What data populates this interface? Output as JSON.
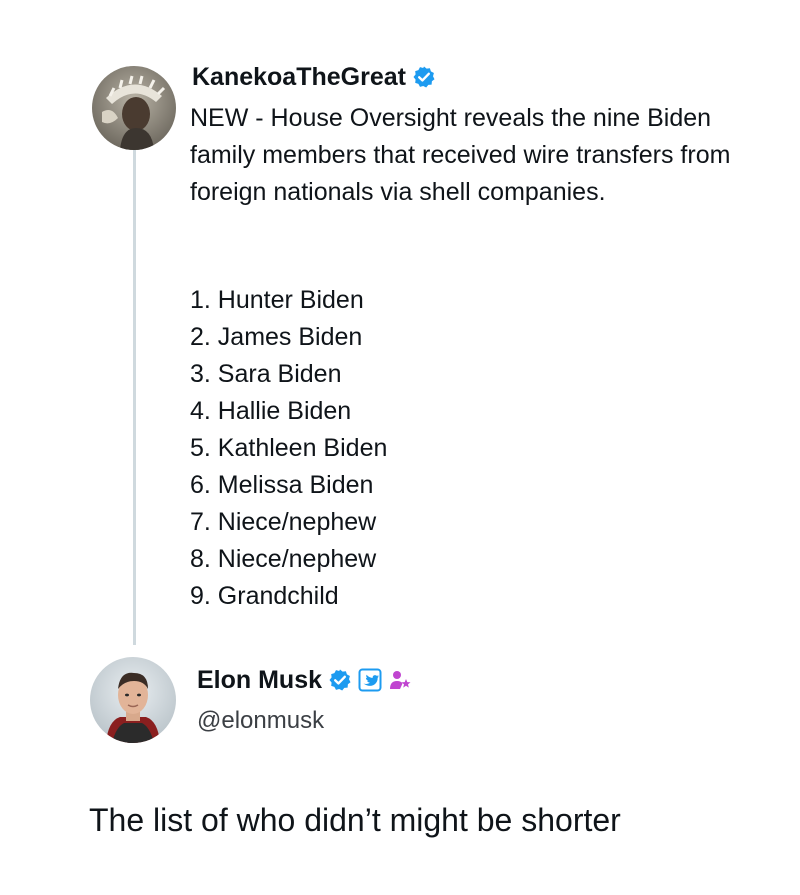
{
  "tweet": {
    "author": {
      "display_name": "KanekoaTheGreat",
      "avatar_icon": "warrior-avatar",
      "verified_icon": "verified-badge",
      "badge_color": "#1d9bf0"
    },
    "text": "NEW - House Oversight reveals the nine Biden family members that received wire transfers from foreign nationals via shell companies.",
    "list": [
      "1. Hunter Biden",
      "2. James Biden",
      "3. Sara Biden",
      "4. Hallie Biden",
      "5. Kathleen Biden",
      "6. Melissa Biden",
      "7. Niece/nephew",
      "8. Niece/nephew",
      "9. Grandchild"
    ]
  },
  "reply": {
    "author": {
      "display_name": "Elon Musk",
      "handle": "@elonmusk",
      "avatar_icon": "elon-avatar",
      "verified_icon": "verified-badge",
      "gov_icon": "twitter-bird-badge",
      "affiliation_icon": "person-star-badge",
      "affiliation_color": "#c045d0"
    },
    "text": "The list of who didn’t might be shorter"
  }
}
